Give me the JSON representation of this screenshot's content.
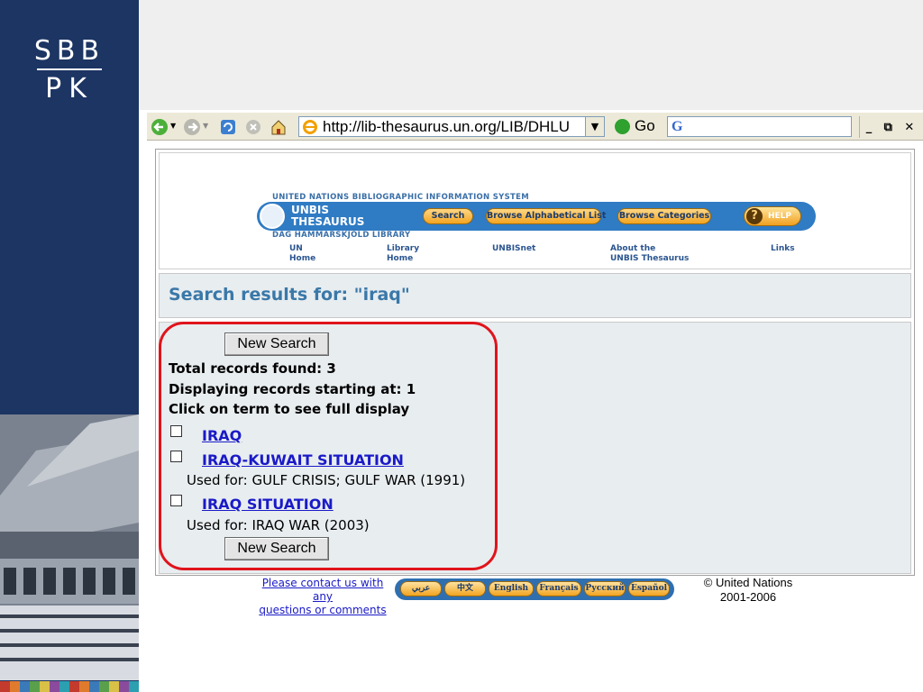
{
  "slide": {
    "logo_line1": "SBB",
    "logo_line2": "PK",
    "strip_colors": [
      "#c33b2c",
      "#e07b2e",
      "#3a7ab8",
      "#5aa04c",
      "#d9c046",
      "#8b4b9c",
      "#2c9fb0",
      "#c33b2c",
      "#e07b2e",
      "#3a7ab8",
      "#5aa04c",
      "#d9c046",
      "#8b4b9c",
      "#2c9fb0"
    ]
  },
  "browser": {
    "address_url": "http://lib-thesaurus.un.org/LIB/DHLU",
    "go_label": "Go",
    "google_letter": "G",
    "icons": [
      "back-arrow-icon",
      "forward-arrow-icon",
      "refresh-icon",
      "stop-icon",
      "home-icon",
      "ie-icon",
      "go-icon",
      "google-icon",
      "minimize-icon",
      "restore-icon",
      "close-icon"
    ]
  },
  "header": {
    "unbis_top": "UNITED NATIONS BIBLIOGRAPHIC INFORMATION SYSTEM",
    "logo_line1": "UNBIS",
    "logo_line2": "THESAURUS",
    "unbis_bottom": "DAG HAMMARSKJÖLD LIBRARY",
    "buttons": [
      "Search",
      "Browse Alphabetical List",
      "Browse Categories"
    ],
    "help_label": "HELP",
    "links": [
      {
        "line1": "UN",
        "line2": "Home"
      },
      {
        "line1": "Library",
        "line2": "Home"
      },
      {
        "line1": "UNBISnet",
        "line2": ""
      },
      {
        "line1": "About the",
        "line2": "UNBIS Thesaurus"
      },
      {
        "line1": "Links",
        "line2": ""
      }
    ]
  },
  "results_header": "Search results for: \"iraq\"",
  "results": {
    "new_search_label": "New Search",
    "total": "Total records found: 3",
    "displaying": "Displaying records starting at: 1",
    "instruction": "Click on term to see full display",
    "items": [
      {
        "term": "IRAQ",
        "used_for": ""
      },
      {
        "term": "IRAQ-KUWAIT SITUATION",
        "used_for": "Used for: GULF CRISIS; GULF WAR (1991)"
      },
      {
        "term": "IRAQ SITUATION",
        "used_for": "Used for: IRAQ WAR (2003)"
      }
    ]
  },
  "footer": {
    "contact_line1": "Please contact us with",
    "contact_line2": "any",
    "contact_line3": "questions or comments",
    "languages": [
      "عربي",
      "中文",
      "English",
      "Français",
      "Русский",
      "Español"
    ],
    "copyright_line1": "© United Nations",
    "copyright_line2": "2001-2006"
  },
  "colors": {
    "sidebar_blue": "#1c3563",
    "unbis_banner": "#2f7bc4",
    "pill_orange": "#f2a421",
    "results_title": "#3a78a8",
    "highlight_red": "#e0141c",
    "link_blue": "#1a1ac8"
  }
}
